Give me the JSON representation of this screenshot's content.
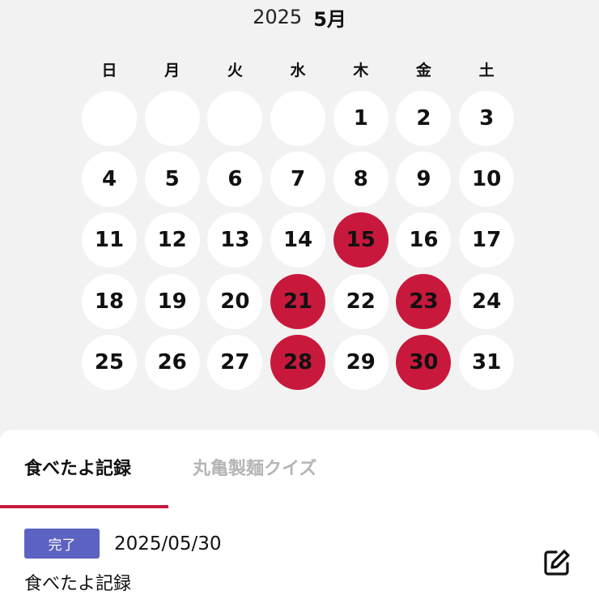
{
  "calendar": {
    "year": "2025",
    "month": "5月",
    "weekdays": [
      "日",
      "月",
      "火",
      "水",
      "木",
      "金",
      "土"
    ],
    "days": [
      "",
      "",
      "",
      "",
      "1",
      "2",
      "3",
      "4",
      "5",
      "6",
      "7",
      "8",
      "9",
      "10",
      "11",
      "12",
      "13",
      "14",
      "15",
      "16",
      "17",
      "18",
      "19",
      "20",
      "21",
      "22",
      "23",
      "24",
      "25",
      "26",
      "27",
      "28",
      "29",
      "30",
      "31"
    ],
    "marked_days": [
      "15",
      "21",
      "23",
      "28",
      "30"
    ],
    "marked_color": "#c8193c"
  },
  "tabs": [
    {
      "label": "食べたよ記録",
      "active": true
    },
    {
      "label": "丸亀製麺クイズ",
      "active": false
    }
  ],
  "entry": {
    "status": "完了",
    "date": "2025/05/30",
    "title": "食べたよ記録",
    "status_color": "#5c63c2"
  },
  "icons": {
    "edit": "edit-icon"
  }
}
